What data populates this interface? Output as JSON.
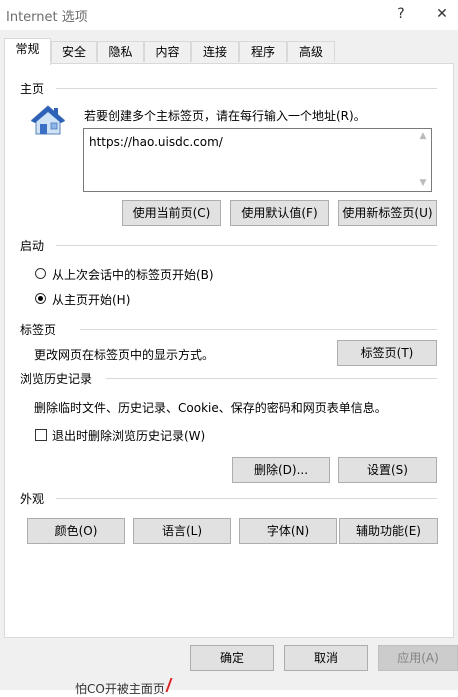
{
  "window": {
    "title": "Internet 选项",
    "help_glyph": "?",
    "close_glyph": "✕"
  },
  "tabs": [
    {
      "label": "常规",
      "active": true
    },
    {
      "label": "安全"
    },
    {
      "label": "隐私"
    },
    {
      "label": "内容"
    },
    {
      "label": "连接"
    },
    {
      "label": "程序"
    },
    {
      "label": "高级"
    }
  ],
  "homepage": {
    "title": "主页",
    "instruction": "若要创建多个主标签页，请在每行输入一个地址(R)。",
    "url": "https://hao.uisdc.com/",
    "buttons": {
      "current": "使用当前页(C)",
      "default": "使用默认值(F)",
      "new_tab": "使用新标签页(U)"
    }
  },
  "startup": {
    "title": "启动",
    "option_last": "从上次会话中的标签页开始(B)",
    "option_home": "从主页开始(H)"
  },
  "tabs_section": {
    "title": "标签页",
    "desc": "更改网页在标签页中的显示方式。",
    "button": "标签页(T)"
  },
  "history": {
    "title": "浏览历史记录",
    "desc": "删除临时文件、历史记录、Cookie、保存的密码和网页表单信息。",
    "checkbox_label": "退出时删除浏览历史记录(W)",
    "delete_button": "删除(D)...",
    "settings_button": "设置(S)"
  },
  "appearance": {
    "title": "外观",
    "buttons": {
      "colors": "颜色(O)",
      "languages": "语言(L)",
      "fonts": "字体(N)",
      "accessibility": "辅助功能(E)"
    }
  },
  "footer": {
    "ok": "确定",
    "cancel": "取消",
    "apply": "应用(A)"
  },
  "background_text": "怕CO开被主面页"
}
